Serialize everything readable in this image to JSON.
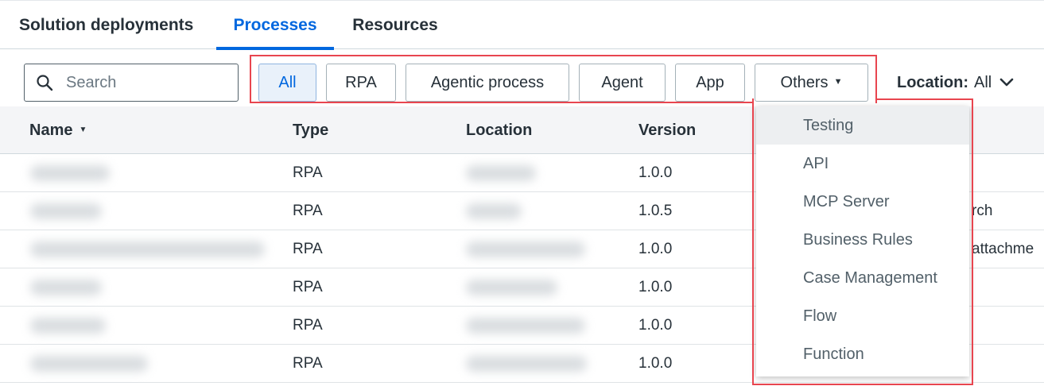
{
  "tabs": [
    {
      "label": "Solution deployments"
    },
    {
      "label": "Processes"
    },
    {
      "label": "Resources"
    }
  ],
  "search": {
    "placeholder": "Search"
  },
  "filters": [
    {
      "label": "All"
    },
    {
      "label": "RPA"
    },
    {
      "label": "Agentic process"
    },
    {
      "label": "Agent"
    },
    {
      "label": "App"
    },
    {
      "label": "Others"
    }
  ],
  "location": {
    "label": "Location:",
    "value": "All"
  },
  "table": {
    "columns": [
      {
        "label": "Name"
      },
      {
        "label": "Type"
      },
      {
        "label": "Location"
      },
      {
        "label": "Version"
      }
    ],
    "rows": [
      {
        "type": "RPA",
        "version": "1.0.0",
        "extra": ""
      },
      {
        "type": "RPA",
        "version": "1.0.5",
        "extra": "rch"
      },
      {
        "type": "RPA",
        "version": "1.0.0",
        "extra": "attachme"
      },
      {
        "type": "RPA",
        "version": "1.0.0",
        "extra": ""
      },
      {
        "type": "RPA",
        "version": "1.0.0",
        "extra": ""
      },
      {
        "type": "RPA",
        "version": "1.0.0",
        "extra": ""
      }
    ]
  },
  "others_menu": [
    {
      "label": "Testing"
    },
    {
      "label": "API"
    },
    {
      "label": "MCP Server"
    },
    {
      "label": "Business Rules"
    },
    {
      "label": "Case Management"
    },
    {
      "label": "Flow"
    },
    {
      "label": "Function"
    }
  ],
  "colors": {
    "accent": "#0067df",
    "highlight": "#e8454f"
  }
}
